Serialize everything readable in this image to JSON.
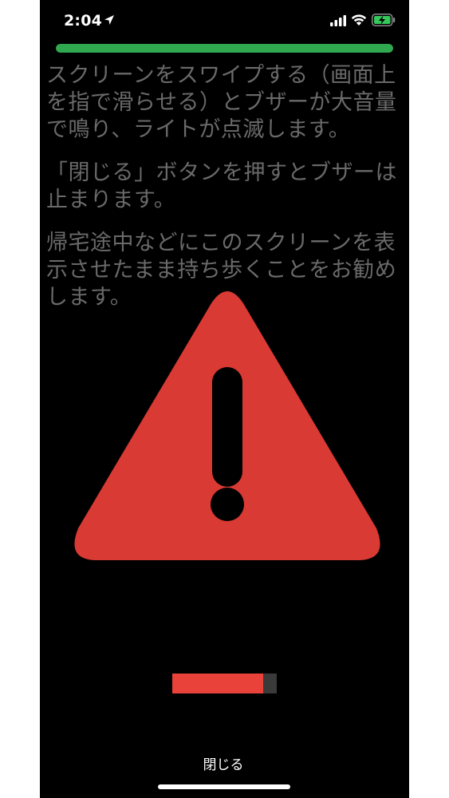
{
  "status_bar": {
    "time": "2:04",
    "icons": [
      "location-arrow-icon",
      "cellular-signal-icon",
      "wifi-icon",
      "battery-charging-icon"
    ]
  },
  "progress": {
    "fraction": 1.0,
    "color": "#2fa84f"
  },
  "instructions": {
    "paragraph_1": "スクリーンをスワイプする（画面上を指で滑らせる）とブザーが大音量で鳴り、ライトが点滅します。",
    "paragraph_2": "「閉じる」ボタンを押すとブザーは止まります。",
    "paragraph_3": "帰宅途中などにこのスクリーンを表示させたまま持ち歩くことをお勧めします。",
    "text_color": "#6a6a6a"
  },
  "warning": {
    "icon": "warning-triangle-icon",
    "color": "#d93a33"
  },
  "level_indicator": {
    "fraction": 0.87,
    "fill_color": "#e8423a",
    "track_color": "#3a3a3a"
  },
  "close_button": {
    "label": "閉じる"
  }
}
